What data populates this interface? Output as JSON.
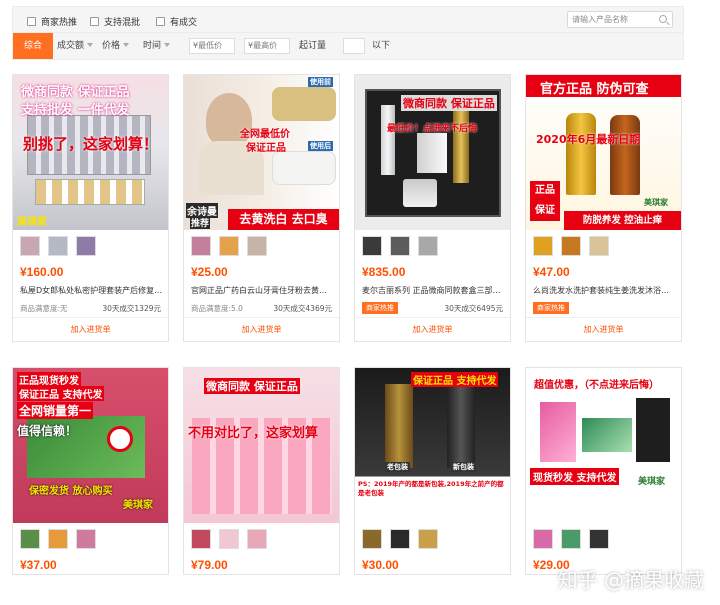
{
  "filters": {
    "checkboxes": [
      "商家热推",
      "支持混批",
      "有成交"
    ],
    "search_placeholder": "请输入产品名称"
  },
  "sort": {
    "active": "综合",
    "items": [
      "成交额",
      "价格",
      "时间"
    ],
    "min_price": "¥最低价",
    "max_price": "¥最高价",
    "moq_label": "起订量",
    "moq_suffix": "以下"
  },
  "common": {
    "satisfaction_label": "商品满意度:",
    "add_label": "加入进货单",
    "hot_tag": "商家热推"
  },
  "products": [
    {
      "price": "¥160.00",
      "title": "私屋D女郎私处私密护理套装产后修复…",
      "satisfaction": "无",
      "sales": "30天成交1329元",
      "image_text": [
        "微商同款 保证正品",
        "支持批发 一件代发",
        "别挑了，这家划算！",
        "美琪家"
      ]
    },
    {
      "price": "¥25.00",
      "title": "官网正品广药白云山牙膏住牙粉去黄…",
      "satisfaction": "5.0",
      "sales": "30天成交4369元",
      "image_text": [
        "使用前",
        "使用后",
        "全网最低价",
        "保证正品",
        "余诗曼",
        "推荐",
        "去黄洗白 去口臭"
      ]
    },
    {
      "price": "¥835.00",
      "title": "麦尔吉丽系列 正品微商同款套盒三部…",
      "tag": true,
      "sales": "30天成交6495元",
      "image_text": [
        "微商同款 保证正品",
        "最低价！点进来不后悔"
      ]
    },
    {
      "price": "¥47.00",
      "title": "么尚洗发水洗护套装纯生姜洗发沐浴…",
      "tag": true,
      "image_text": [
        "官方正品 防伪可查",
        "2020年6月最新日期",
        "正品",
        "保证",
        "防脱养发 控油止痒",
        "美琪家"
      ]
    },
    {
      "price": "¥37.00",
      "image_text": [
        "正品现货秒发",
        "保证正品 支持代发",
        "全网销量第一",
        "值得信赖！",
        "保密发货 放心购买",
        "美琪家"
      ]
    },
    {
      "price": "¥79.00",
      "image_text": [
        "微商同款 保证正品",
        "不用对比了，这家划算"
      ]
    },
    {
      "price": "¥30.00",
      "image_text": [
        "保证正品 支持代发",
        "老包装",
        "新包装",
        "PS：2019年产的都是新包装,2019年之前产的都是老包装"
      ]
    },
    {
      "price": "¥29.00",
      "image_text": [
        "超值优惠，（不点进来后悔）",
        "现货秒发 支持代发",
        "美琪家"
      ]
    }
  ],
  "watermark": "知乎 @摘果收藏",
  "colors": {
    "accent": "#ff5000",
    "sort_active": "#ff6f1f"
  }
}
